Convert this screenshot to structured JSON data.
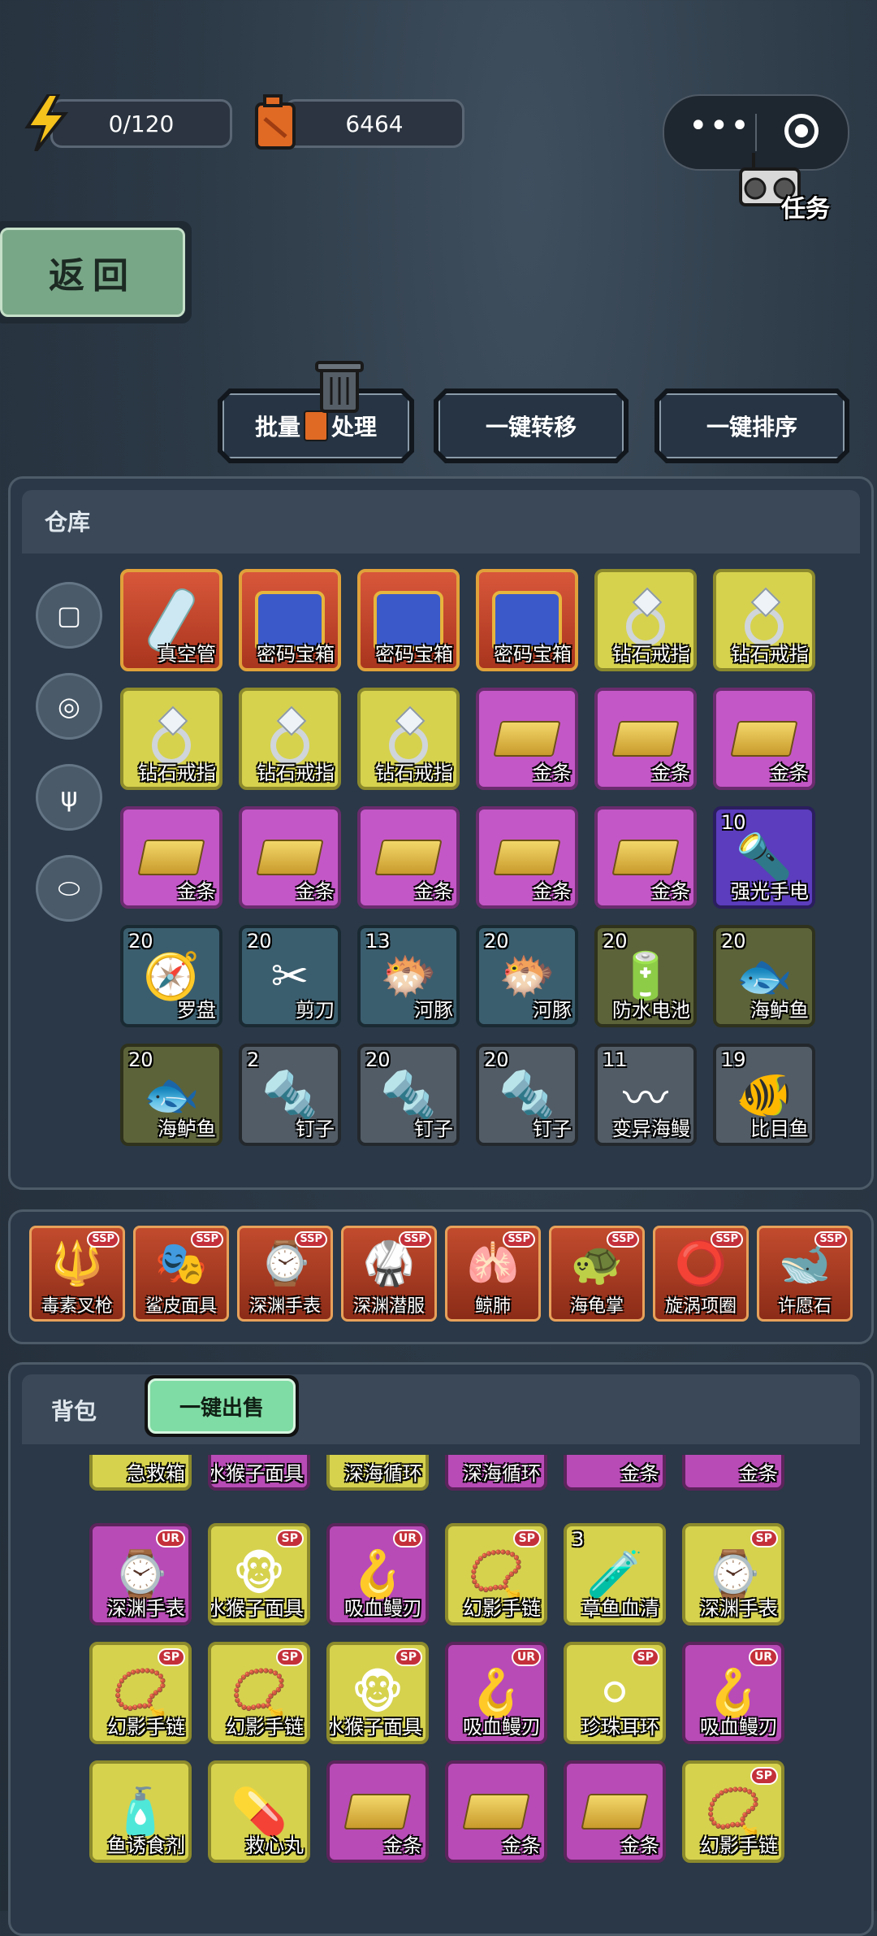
{
  "top": {
    "energy": "0/120",
    "fuel": "6464",
    "task_label": "任务"
  },
  "back_label": "返回",
  "actions": {
    "batch_prefix": "批量",
    "batch_suffix": "处理",
    "transfer": "一键转移",
    "sort": "一键排序"
  },
  "warehouse": {
    "title": "仓库",
    "rows": [
      [
        {
          "name": "真空管",
          "rarity": "orange",
          "icon": "vacuum-tube-icon"
        },
        {
          "name": "密码宝箱",
          "rarity": "orange",
          "icon": "treasure-chest-icon"
        },
        {
          "name": "密码宝箱",
          "rarity": "orange",
          "icon": "treasure-chest-icon"
        },
        {
          "name": "密码宝箱",
          "rarity": "orange",
          "icon": "treasure-chest-icon"
        },
        {
          "name": "钻石戒指",
          "rarity": "yellow",
          "icon": "diamond-ring-icon"
        },
        {
          "name": "钻石戒指",
          "rarity": "yellow",
          "icon": "diamond-ring-icon"
        }
      ],
      [
        {
          "name": "钻石戒指",
          "rarity": "yellow",
          "icon": "diamond-ring-icon"
        },
        {
          "name": "钻石戒指",
          "rarity": "yellow",
          "icon": "diamond-ring-icon"
        },
        {
          "name": "钻石戒指",
          "rarity": "yellow",
          "icon": "diamond-ring-icon"
        },
        {
          "name": "金条",
          "rarity": "purple",
          "icon": "gold-bar-icon"
        },
        {
          "name": "金条",
          "rarity": "purple",
          "icon": "gold-bar-icon"
        },
        {
          "name": "金条",
          "rarity": "purple",
          "icon": "gold-bar-icon"
        }
      ],
      [
        {
          "name": "金条",
          "rarity": "purple",
          "icon": "gold-bar-icon"
        },
        {
          "name": "金条",
          "rarity": "purple",
          "icon": "gold-bar-icon"
        },
        {
          "name": "金条",
          "rarity": "purple",
          "icon": "gold-bar-icon"
        },
        {
          "name": "金条",
          "rarity": "purple",
          "icon": "gold-bar-icon"
        },
        {
          "name": "金条",
          "rarity": "purple",
          "icon": "gold-bar-icon"
        },
        {
          "name": "强光手电",
          "rarity": "violet",
          "icon": "flashlight-icon",
          "count": "10"
        }
      ],
      [
        {
          "name": "罗盘",
          "rarity": "teal",
          "icon": "compass-icon",
          "count": "20"
        },
        {
          "name": "剪刀",
          "rarity": "teal",
          "icon": "scissors-icon",
          "count": "20"
        },
        {
          "name": "河豚",
          "rarity": "teal",
          "icon": "pufferfish-icon",
          "count": "13"
        },
        {
          "name": "河豚",
          "rarity": "teal",
          "icon": "pufferfish-icon",
          "count": "20"
        },
        {
          "name": "防水电池",
          "rarity": "olive",
          "icon": "battery-icon",
          "count": "20"
        },
        {
          "name": "海鲈鱼",
          "rarity": "olive",
          "icon": "fish-icon",
          "count": "20"
        }
      ],
      [
        {
          "name": "海鲈鱼",
          "rarity": "olive",
          "icon": "fish-icon",
          "count": "20"
        },
        {
          "name": "钉子",
          "rarity": "gray",
          "icon": "nail-icon",
          "count": "2"
        },
        {
          "name": "钉子",
          "rarity": "gray",
          "icon": "nail-icon",
          "count": "20"
        },
        {
          "name": "钉子",
          "rarity": "gray",
          "icon": "nail-icon",
          "count": "20"
        },
        {
          "name": "变异海鳗",
          "rarity": "gray",
          "icon": "eel-icon",
          "count": "11"
        },
        {
          "name": "比目鱼",
          "rarity": "gray",
          "icon": "flatfish-icon",
          "count": "19"
        }
      ]
    ]
  },
  "equipped": [
    {
      "name": "毒素叉枪",
      "badge": "SSP",
      "icon": "trident-icon"
    },
    {
      "name": "鲨皮面具",
      "badge": "SSP",
      "icon": "mask-icon"
    },
    {
      "name": "深渊手表",
      "badge": "SSP",
      "icon": "watch-icon"
    },
    {
      "name": "深渊潜服",
      "badge": "SSP",
      "icon": "diving-suit-icon"
    },
    {
      "name": "鲸肺",
      "badge": "SSP",
      "icon": "lung-icon"
    },
    {
      "name": "海龟掌",
      "badge": "SSP",
      "icon": "turtle-claw-icon"
    },
    {
      "name": "旋涡项圈",
      "badge": "SSP",
      "icon": "necklace-icon"
    },
    {
      "name": "许愿石",
      "badge": "SSP",
      "icon": "wish-stone-icon"
    }
  ],
  "backpack": {
    "title": "背包",
    "sell_all": "一键出售",
    "partial_row": [
      {
        "name": "急救箱",
        "rarity": "yellow"
      },
      {
        "name": "水猴子面具",
        "rarity": "mag"
      },
      {
        "name": "深海循环",
        "rarity": "yellow"
      },
      {
        "name": "深海循环",
        "rarity": "mag"
      },
      {
        "name": "金条",
        "rarity": "mag"
      },
      {
        "name": "金条",
        "rarity": "mag"
      }
    ],
    "rows": [
      [
        {
          "name": "深渊手表",
          "rarity": "mag",
          "badge": "UR",
          "icon": "watch-icon"
        },
        {
          "name": "水猴子面具",
          "rarity": "yellow",
          "badge": "SP",
          "icon": "monkey-mask-icon"
        },
        {
          "name": "吸血鳗刃",
          "rarity": "mag",
          "badge": "UR",
          "icon": "eel-blade-icon"
        },
        {
          "name": "幻影手链",
          "rarity": "yellow",
          "badge": "SP",
          "icon": "bracelet-icon"
        },
        {
          "name": "章鱼血清",
          "rarity": "yellow",
          "icon": "serum-icon",
          "count": "3"
        },
        {
          "name": "深渊手表",
          "rarity": "yellow",
          "badge": "SP",
          "icon": "watch-icon"
        }
      ],
      [
        {
          "name": "幻影手链",
          "rarity": "yellow",
          "badge": "SP",
          "icon": "bracelet-icon"
        },
        {
          "name": "幻影手链",
          "rarity": "yellow",
          "badge": "SP",
          "icon": "bracelet-icon"
        },
        {
          "name": "水猴子面具",
          "rarity": "yellow",
          "badge": "SP",
          "icon": "monkey-mask-icon"
        },
        {
          "name": "吸血鳗刃",
          "rarity": "mag",
          "badge": "UR",
          "icon": "eel-blade-icon"
        },
        {
          "name": "珍珠耳环",
          "rarity": "yellow",
          "badge": "SP",
          "icon": "pearl-earring-icon"
        },
        {
          "name": "吸血鳗刃",
          "rarity": "mag",
          "badge": "UR",
          "icon": "eel-blade-icon"
        }
      ],
      [
        {
          "name": "鱼诱食剂",
          "rarity": "yellow",
          "icon": "fish-bait-icon"
        },
        {
          "name": "救心丸",
          "rarity": "yellow",
          "icon": "pill-bottle-icon"
        },
        {
          "name": "金条",
          "rarity": "mag",
          "icon": "gold-bar-icon"
        },
        {
          "name": "金条",
          "rarity": "mag",
          "icon": "gold-bar-icon"
        },
        {
          "name": "金条",
          "rarity": "mag",
          "icon": "gold-bar-icon"
        },
        {
          "name": "幻影手链",
          "rarity": "yellow",
          "badge": "SP",
          "icon": "bracelet-icon"
        }
      ]
    ]
  }
}
